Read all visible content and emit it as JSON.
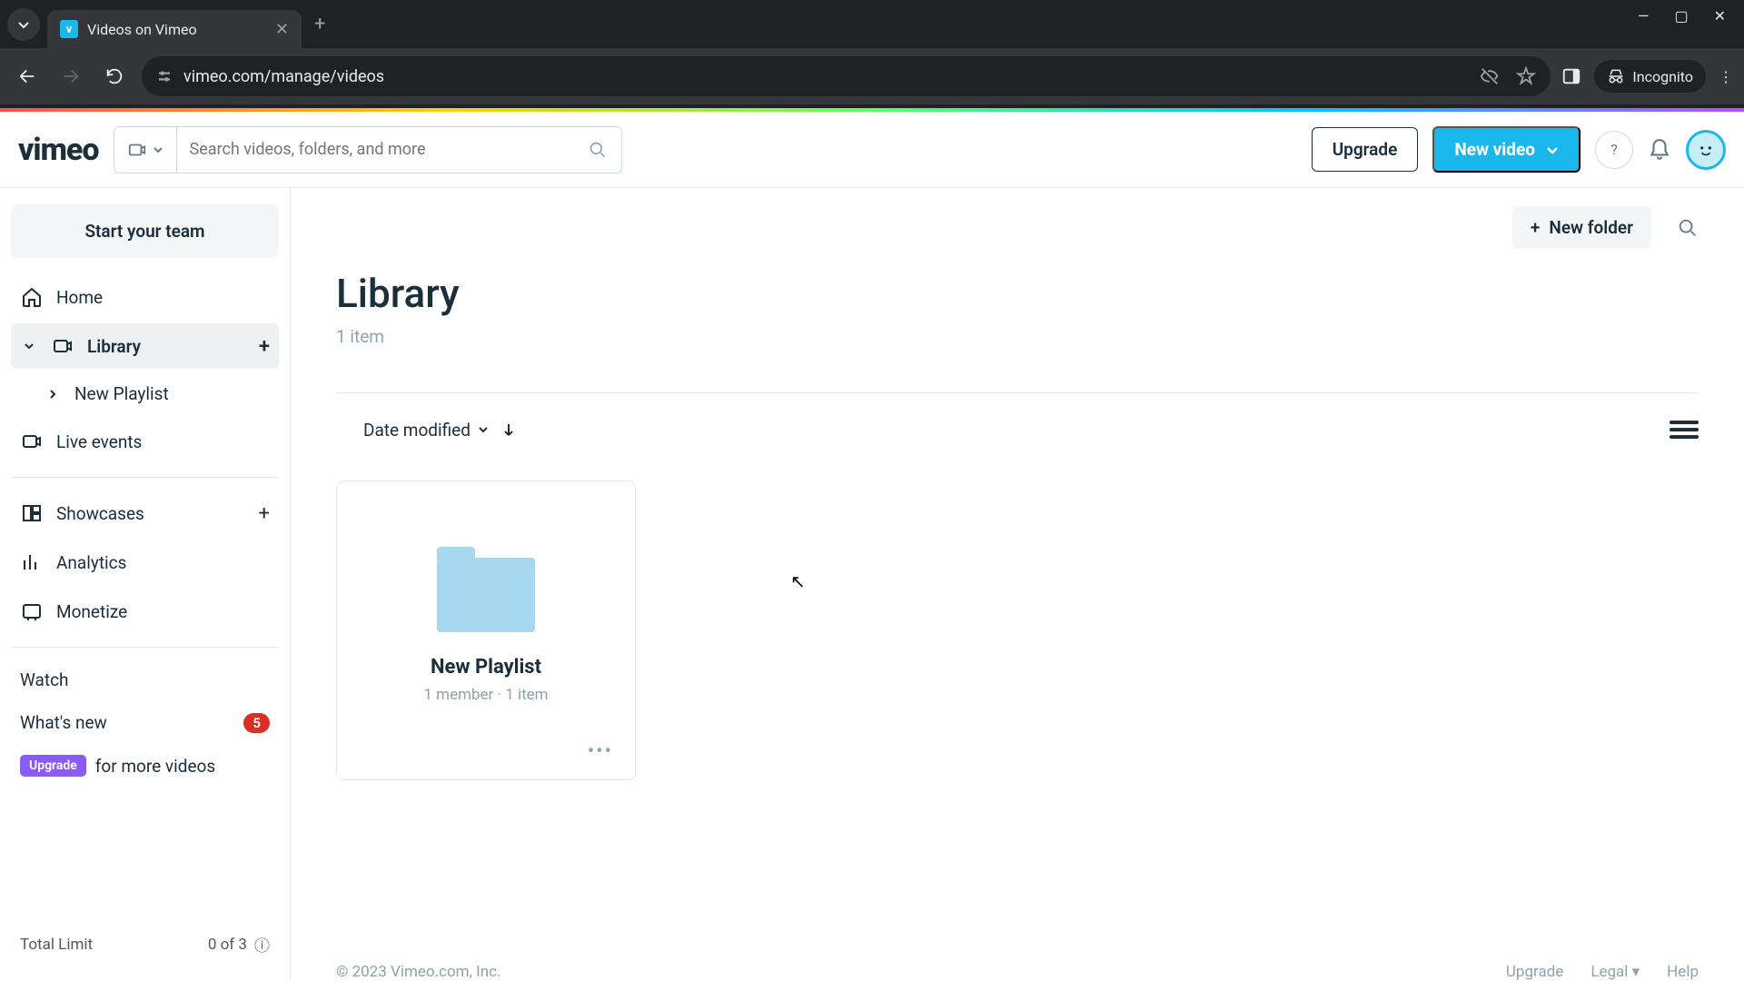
{
  "browser": {
    "tab_title": "Videos on Vimeo",
    "url": "vimeo.com/manage/videos",
    "incognito": "Incognito"
  },
  "header": {
    "logo": "vimeo",
    "search_placeholder": "Search videos, folders, and more",
    "upgrade": "Upgrade",
    "new_video": "New video"
  },
  "sidebar": {
    "start_team": "Start your team",
    "home": "Home",
    "library": "Library",
    "new_playlist": "New Playlist",
    "live_events": "Live events",
    "showcases": "Showcases",
    "analytics": "Analytics",
    "monetize": "Monetize",
    "watch": "Watch",
    "whats_new": "What's new",
    "whats_new_count": "5",
    "upgrade_pill": "Upgrade",
    "upgrade_text": "for more videos",
    "total_limit_label": "Total Limit",
    "total_limit_value": "0 of 3"
  },
  "content": {
    "new_folder": "New folder",
    "title": "Library",
    "item_count": "1 item",
    "sort": "Date modified",
    "folder": {
      "name": "New Playlist",
      "members": "1 member",
      "items": "1 item"
    },
    "footer_copyright": "© 2023 Vimeo.com, Inc.",
    "footer_upgrade": "Upgrade",
    "footer_legal": "Legal",
    "footer_help": "Help"
  }
}
